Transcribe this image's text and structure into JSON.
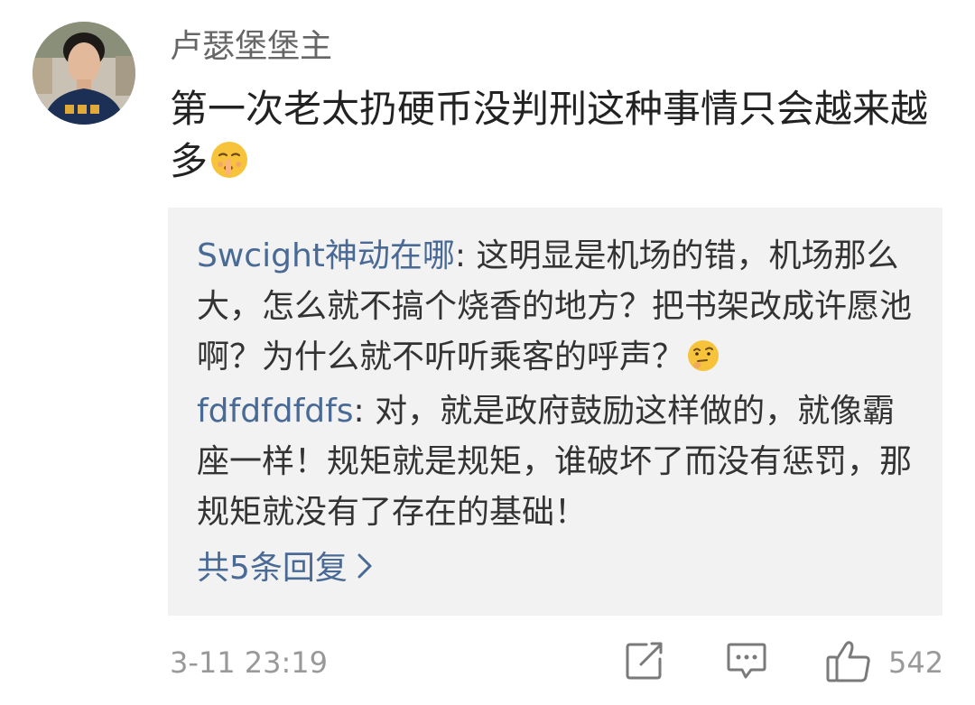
{
  "post": {
    "username": "卢瑟堡堡主",
    "comment_text": "第一次老太扔硬币没判刑这种事情只会越来越多",
    "comment_emoji": "shush-emoji",
    "timestamp": "3-11 23:19",
    "like_count": "542"
  },
  "replies": [
    {
      "author": "Swcight神动在哪",
      "separator": ": ",
      "text": "这明显是机场的错，机场那么大，怎么就不搞个烧香的地方？把书架改成许愿池啊？为什么就不听听乘客的呼声？",
      "emoji": "thinking-emoji"
    },
    {
      "author": "fdfdfdfdfs",
      "separator": ": ",
      "text": "对，就是政府鼓励这样做的，就像霸座一样！规矩就是规矩，谁破坏了而没有惩罚，那规矩就没有了存在的基础！"
    }
  ],
  "more_replies_label": "共5条回复",
  "icons": {
    "share": "share-icon",
    "comment": "comment-icon",
    "like": "thumbs-up-icon",
    "more": "chevron-right-icon"
  },
  "colors": {
    "link_blue": "#4a6a96",
    "reply_bg": "#f2f2f2",
    "meta_gray": "#999999"
  }
}
